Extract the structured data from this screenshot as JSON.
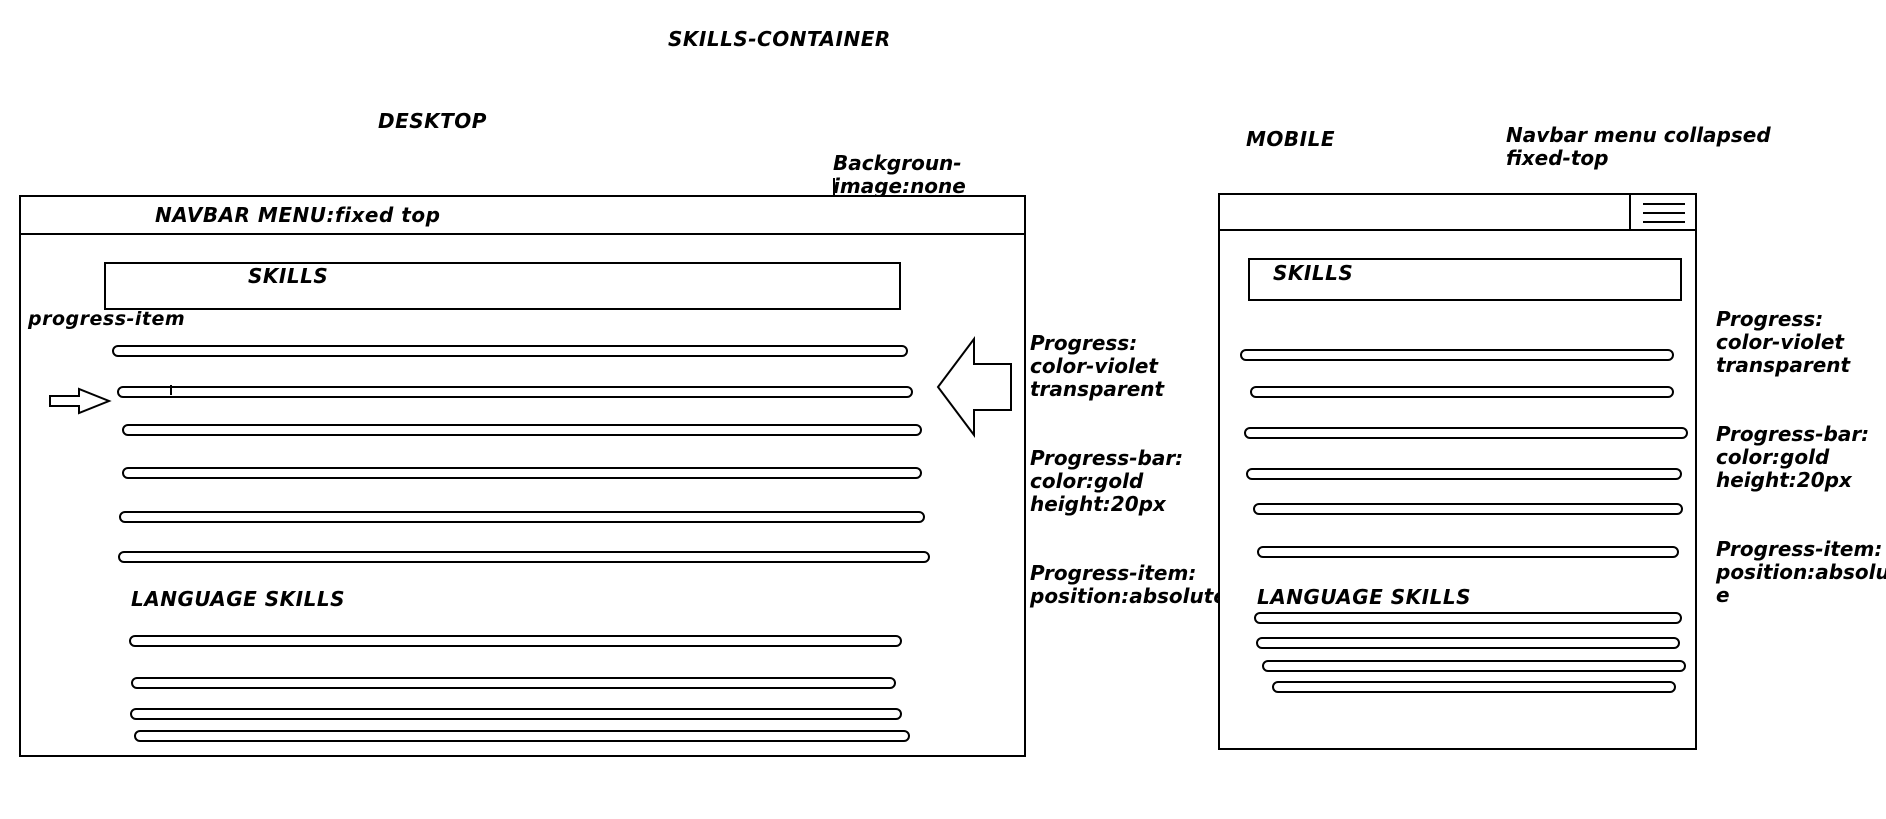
{
  "title": "SKILLS-CONTAINER",
  "desktop": {
    "label": "DESKTOP",
    "background_note": "Backgroun-\nimage:none",
    "navbar_label": "NAVBAR MENU:fixed top",
    "skills_title": "SKILLS",
    "progress_item_label": "progress-item",
    "skills_bar_count": 6,
    "language_title": "LANGUAGE SKILLS",
    "language_bar_count": 4,
    "notes": [
      "Progress:\ncolor-violet\ntransparent",
      "Progress-bar:\ncolor:gold\nheight:20px",
      "Progress-item:\nposition:absolute"
    ]
  },
  "mobile": {
    "label": "MOBILE",
    "navbar_note": "Navbar menu collapsed\nfixed-top",
    "skills_title": "SKILLS",
    "skills_bar_count": 6,
    "language_title": "LANGUAGE SKILLS",
    "language_bar_count": 4,
    "notes": [
      "Progress:\ncolor-violet\ntransparent",
      "Progress-bar:\ncolor:gold\nheight:20px",
      "Progress-item:\nposition:absolut\ne"
    ]
  }
}
